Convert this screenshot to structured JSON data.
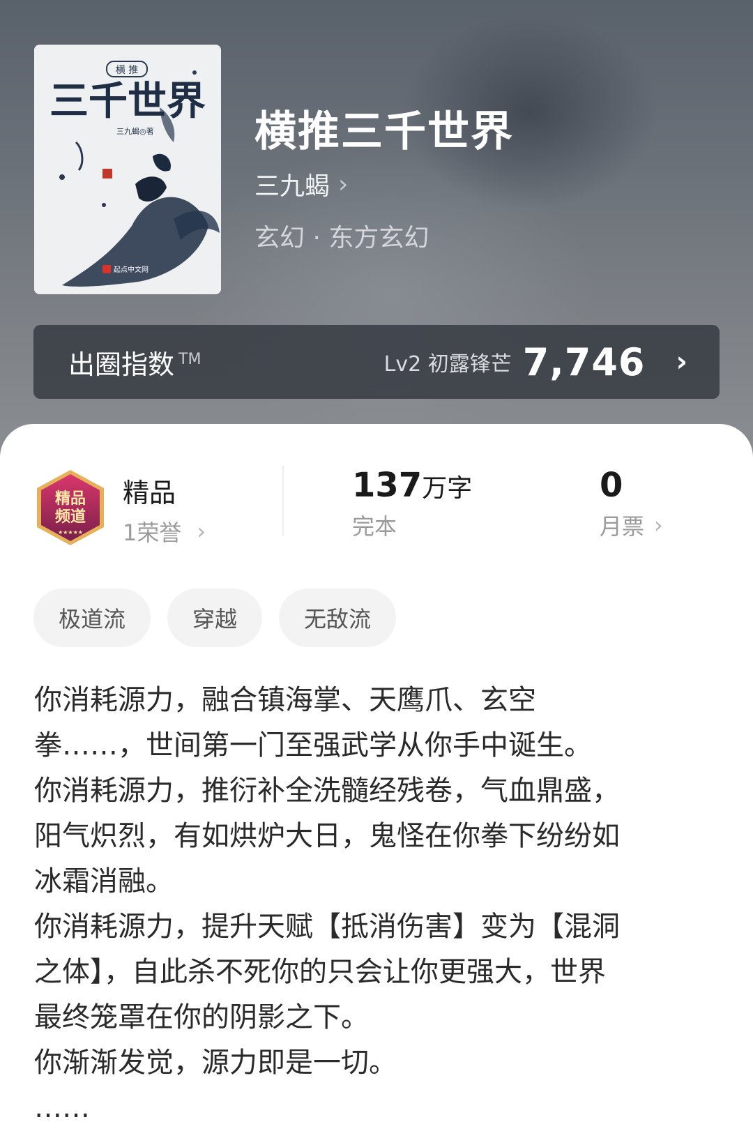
{
  "book": {
    "title": "横推三千世界",
    "author": "三九蝎",
    "genre": "玄幻 · 东方玄幻",
    "cover": {
      "tag": "横 推",
      "title": "三千世界",
      "author_line": "三九蝎◎著",
      "publisher": "起点中文网"
    }
  },
  "index": {
    "label": "出圈指数",
    "mark": "TM",
    "level": "Lv2 初露锋芒",
    "score": "7,746"
  },
  "stats": {
    "quality": {
      "title": "精品",
      "honor": "1荣誉"
    },
    "words": {
      "number": "137",
      "unit": "万字",
      "status": "完本"
    },
    "votes": {
      "number": "0",
      "label": "月票"
    }
  },
  "tags": [
    "极道流",
    "穿越",
    "无敌流"
  ],
  "synopsis": [
    "你消耗源力，融合镇海掌、天鹰爪、玄空",
    "拳……，世间第一门至强武学从你手中诞生。",
    "你消耗源力，推衍补全洗髓经残卷，气血鼎盛，",
    "阳气炽烈，有如烘炉大日，鬼怪在你拳下纷纷如",
    "冰霜消融。",
    "你消耗源力，提升天赋【抵消伤害】变为【混洞",
    "之体】，自此杀不死你的只会让你更强大，世界",
    "最终笼罩在你的阴影之下。",
    "你渐渐发觉，源力即是一切。",
    "……"
  ],
  "icons": {
    "author_chevron": "chevron-right-icon",
    "index_chevron": "chevron-right-icon",
    "honor_chevron": "chevron-right-icon",
    "votes_chevron": "chevron-right-icon",
    "badge": "quality-badge-icon"
  },
  "badge_text": "精品频道"
}
